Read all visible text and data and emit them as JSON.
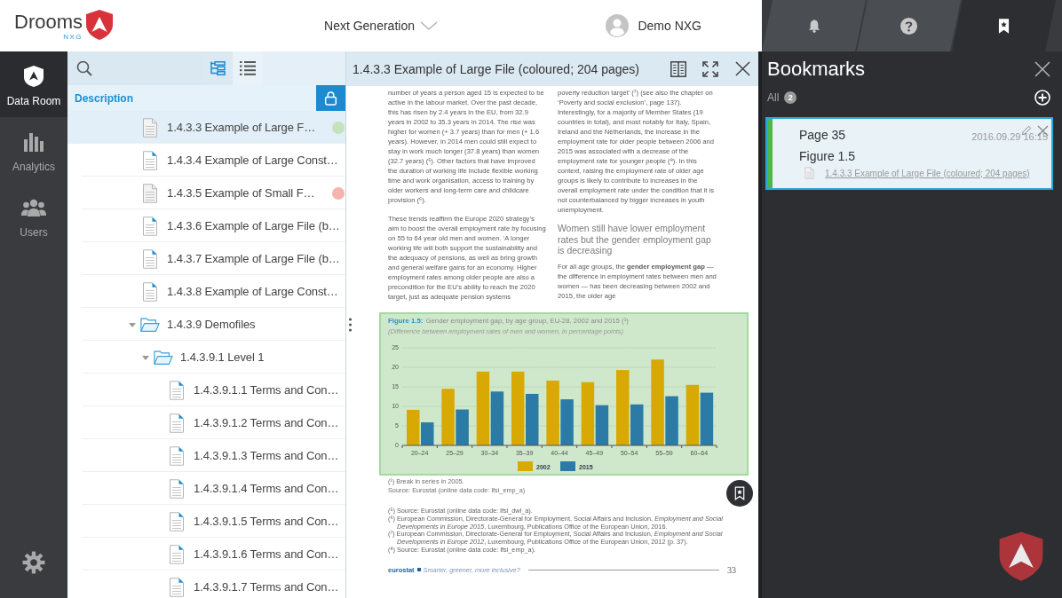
{
  "header": {
    "logo": {
      "name": "Drooms",
      "edition": "NXG"
    },
    "project": "Next Generation",
    "user": "Demo NXG"
  },
  "top_tabs": [
    {
      "kind": "notifications",
      "selected": false
    },
    {
      "kind": "help",
      "selected": false
    },
    {
      "kind": "bookmarks",
      "selected": true
    }
  ],
  "nav": {
    "items": [
      {
        "kind": "data_room",
        "label": "Data Room",
        "selected": true
      },
      {
        "kind": "analytics",
        "label": "Analytics",
        "selected": false
      },
      {
        "kind": "users",
        "label": "Users",
        "selected": false
      }
    ]
  },
  "files": {
    "views": [
      {
        "kind": "tree",
        "selected": true
      },
      {
        "kind": "list",
        "selected": false
      }
    ],
    "column": "Description",
    "tree": [
      {
        "kind": "file",
        "label": "1.4.3.3 Example of Large F…",
        "selected": true,
        "unread": false,
        "color": "#c4e3bc"
      },
      {
        "kind": "file",
        "label": "1.4.3.4 Example of Large Const…",
        "selected": false,
        "unread": true
      },
      {
        "kind": "file",
        "label": "1.4.3.5 Example of Small F…",
        "selected": false,
        "unread": false,
        "color": "#f5b5ad"
      },
      {
        "kind": "file",
        "label": "1.4.3.6 Example of Large File (b…",
        "selected": false,
        "unread": true
      },
      {
        "kind": "file",
        "label": "1.4.3.7 Example of Large File (b…",
        "selected": false,
        "unread": true
      },
      {
        "kind": "file",
        "label": "1.4.3.8 Example of Large Const…",
        "selected": false,
        "unread": true
      },
      {
        "kind": "folder",
        "label": "1.4.3.9 Demofiles",
        "selected": false,
        "expanded": true,
        "children": [
          {
            "kind": "folder",
            "label": "1.4.3.9.1 Level 1",
            "selected": false,
            "expanded": true,
            "children": [
              {
                "kind": "file",
                "label": "1.4.3.9.1.1 Terms and Con…",
                "selected": false,
                "unread": true
              },
              {
                "kind": "file",
                "label": "1.4.3.9.1.2 Terms and Con…",
                "selected": false,
                "unread": true
              },
              {
                "kind": "file",
                "label": "1.4.3.9.1.3 Terms and Con…",
                "selected": false,
                "unread": true
              },
              {
                "kind": "file",
                "label": "1.4.3.9.1.4 Terms and Con…",
                "selected": false,
                "unread": true
              },
              {
                "kind": "file",
                "label": "1.4.3.9.1.5 Terms and Con…",
                "selected": false,
                "unread": true
              },
              {
                "kind": "file",
                "label": "1.4.3.9.1.6 Terms and Con…",
                "selected": false,
                "unread": true
              },
              {
                "kind": "file",
                "label": "1.4.3.9.1.7 Terms and Con…",
                "selected": false,
                "unread": true
              }
            ]
          }
        ]
      }
    ]
  },
  "viewer": {
    "title": "1.4.3.3 Example of Large File (coloured; 204 pages)",
    "page": {
      "columns": [
        [
          {
            "kind": "paragraph",
            "text": "number of years a person aged 15 is expected to be active in the labour market. Over the past decade, this has risen by 2.4 years in the EU, from 32.9 years in 2002 to 35.3 years in 2014. The rise was higher for women (+ 3.7 years) than for men (+ 1.6 years). However, in 2014 men could still expect to stay in work much longer (37.8 years) than women (32.7 years) (⁵). Other factors that have improved the duration of working life include flexible working time and work organisation, access to training by older workers and long-term care and childcare provision (⁶)."
          },
          {
            "kind": "paragraph",
            "text": "These trends reaffirm the Europe 2020 strategy’s aim to boost the overall employment rate by focusing on 55 to 64 year old men and women. ‘A longer working life will both support the sustainability and the adequacy of pensions, as well as bring growth and general welfare gains for an economy. Higher employment rates among older people are also a precondition for the EU’s ability to reach the 2020 target, just as adequate pension systems"
          }
        ],
        [
          {
            "kind": "paragraph",
            "text": "poverty reduction target’ (⁷) (see also the chapter on ‘Poverty and social exclusion’, page 137). Interestingly, for a majority of Member States (19 countries in total), and most notably for Italy, Spain, Ireland and the Netherlands, the increase in the employment rate for older people between 2006 and 2015 was associated with a decrease of the employment rate for younger people (⁸). In this context, raising the employment rate of older age groups is likely to contribute to increases in the overall employment rate under the condition that it is not counterbalanced by bigger increases in youth unemployment."
          },
          {
            "kind": "heading",
            "text": "Women still have lower employment rates but the gender employment gap is decreasing"
          },
          {
            "kind": "paragraph",
            "text": "For all age groups, the **gender employment gap** — the difference in employment rates between men and women — has been decreasing between 2002 and 2015, the older age"
          }
        ]
      ],
      "figure": {
        "highlighted": true,
        "label": "Figure 1.5:",
        "subtitle": "(Difference between employment rates of men and women, in percentage points)",
        "chart_data": {
          "type": "bar",
          "title": "Gender employment gap, by age group, EU-28, 2002 and 2015 (¹)",
          "categories": [
            "20–24",
            "25–29",
            "30–34",
            "35–39",
            "40–44",
            "45–49",
            "50–54",
            "55–59",
            "60–64"
          ],
          "series": [
            {
              "name": "2002",
              "color": "#d9a903",
              "values": [
                9.1,
                14.5,
                18.9,
                18.9,
                16.6,
                16.2,
                19.3,
                22.0,
                15.5
              ]
            },
            {
              "name": "2015",
              "color": "#2c7ba6",
              "values": [
                5.9,
                9.2,
                13.8,
                13.2,
                11.8,
                10.3,
                10.5,
                12.6,
                13.5
              ]
            }
          ],
          "ylim": [
            0,
            25
          ],
          "yticks": [
            0,
            5,
            10,
            15,
            20,
            25
          ],
          "grid": true,
          "legend": true
        }
      },
      "notes": [
        "(¹) Break in series in 2005.",
        "Source: Eurostat (online data code: lfsi_emp_a)"
      ],
      "footnotes": [
        "(⁵) Source: Eurostat (online data code: lfsi_dwl_a).",
        "(⁶) European Commission, Directorate-General for Employment, Social Affairs and Inclusion, *Employment and Social Developments in Europe 2015*, Luxembourg, Publications Office of the European Union, 2016.",
        "(⁷) European Commission, Directorate-General for Employment, Social Affairs and Inclusion, *Employment and Social Developments in Europe 2012*, Luxembourg, Publications Office of the European Union, 2012 (p. 37).",
        "(⁸) Source: Eurostat (online data code: lfsi_emp_a)."
      ],
      "footer": {
        "publisher": "eurostat",
        "title": "Smarter, greener, more inclusive?",
        "page_number": "33"
      }
    }
  },
  "bookmarks_panel": {
    "title": "Bookmarks",
    "filter": "All",
    "count": "2",
    "bookmarks": [
      {
        "page": "Page 35",
        "date": "2016.09.29 16:15",
        "label": "Figure 1.5",
        "file": "1.4.3.3 Example of Large File (coloured; 204 pages)",
        "selected": true,
        "color": "#4db848"
      }
    ]
  }
}
